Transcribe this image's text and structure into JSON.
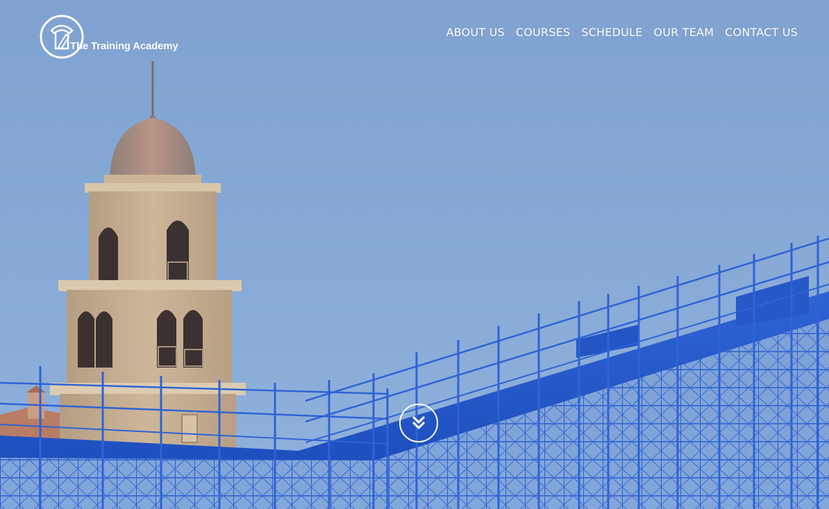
{
  "brand": {
    "name": "The Training Academy",
    "logo_icon": "pencil-shield-icon"
  },
  "nav": {
    "items": [
      {
        "label": "ABOUT US"
      },
      {
        "label": "COURSES"
      },
      {
        "label": "SCHEDULE"
      },
      {
        "label": "OUR TEAM"
      },
      {
        "label": "CONTACT US"
      }
    ]
  },
  "hero": {
    "scroll_icon": "chevron-double-down-icon",
    "colors": {
      "sky": "#86a9d6",
      "scaffold": "#2a5fd0",
      "stone": "#c4ad92",
      "dome": "#a88f80",
      "text": "#ffffff"
    }
  }
}
